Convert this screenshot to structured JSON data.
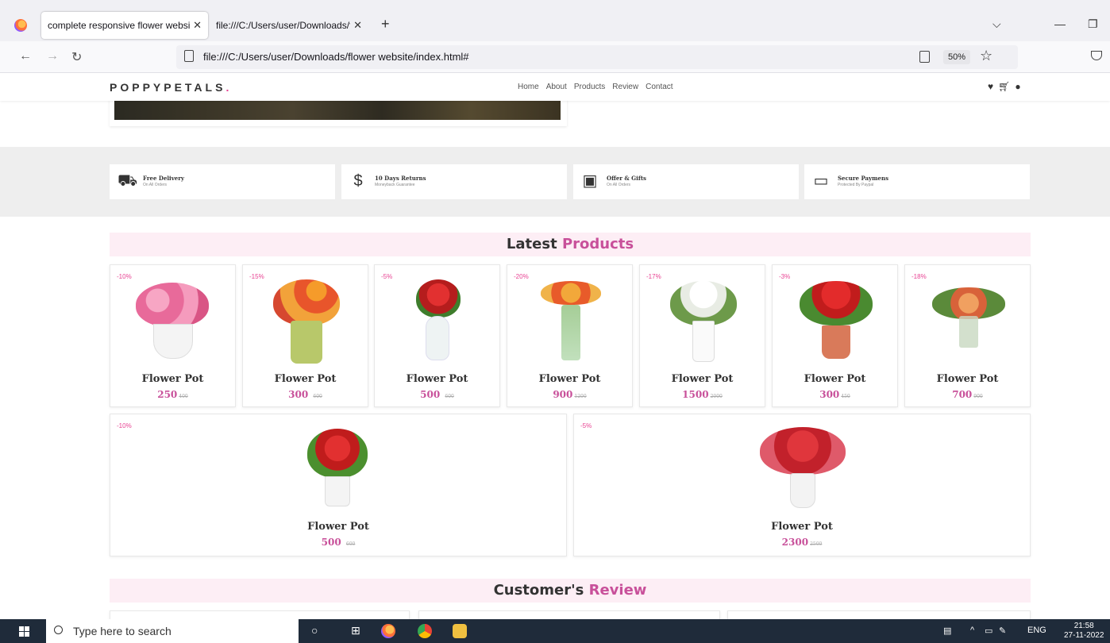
{
  "browser": {
    "tabs": [
      {
        "label": "complete responsive flower website",
        "active": true
      },
      {
        "label": "file:///C:/Users/user/Downloads/flo",
        "active": false
      }
    ],
    "url": "file:///C:/Users/user/Downloads/flower website/index.html#",
    "zoom": "50%"
  },
  "site": {
    "logo": "POPPYPETALS",
    "logo_dot": ".",
    "nav": [
      "Home",
      "About",
      "Products",
      "Review",
      "Contact"
    ]
  },
  "features": [
    {
      "title": "Free Delivery",
      "sub": "On All Orders",
      "icon": "cart-icon"
    },
    {
      "title": "10 Days Returns",
      "sub": "Moneyback Guarantee",
      "icon": "money-bag-icon"
    },
    {
      "title": "Offer & Gifts",
      "sub": "On All Orders",
      "icon": "gift-icon"
    },
    {
      "title": "Secure Paymens",
      "sub": "Protected By Paypal",
      "icon": "card-icon"
    }
  ],
  "latest": {
    "prefix": "Latest ",
    "accent": "Products"
  },
  "products": [
    {
      "discount": "-10%",
      "name": "Flower Pot",
      "price": "250",
      "old": "400"
    },
    {
      "discount": "-15%",
      "name": "Flower Pot",
      "price": "300 ",
      "old": "600"
    },
    {
      "discount": "-5%",
      "name": "Flower Pot",
      "price": "500 ",
      "old": "600"
    },
    {
      "discount": "-20%",
      "name": "Flower Pot",
      "price": "900",
      "old": "1200"
    },
    {
      "discount": "-17%",
      "name": "Flower Pot",
      "price": "1500",
      "old": "2000"
    },
    {
      "discount": "-3%",
      "name": "Flower Pot",
      "price": "300",
      "old": "450"
    },
    {
      "discount": "-18%",
      "name": "Flower Pot",
      "price": "700",
      "old": "900"
    },
    {
      "discount": "-10%",
      "name": "Flower Pot",
      "price": "500 ",
      "old": "600"
    },
    {
      "discount": "-5%",
      "name": "Flower Pot",
      "price": "2300",
      "old": "2500"
    }
  ],
  "review": {
    "prefix": "Customer's ",
    "accent": "Review"
  },
  "taskbar": {
    "search_placeholder": "Type here to search",
    "lang": "ENG",
    "time": "21:58",
    "date": "27-11-2022"
  }
}
